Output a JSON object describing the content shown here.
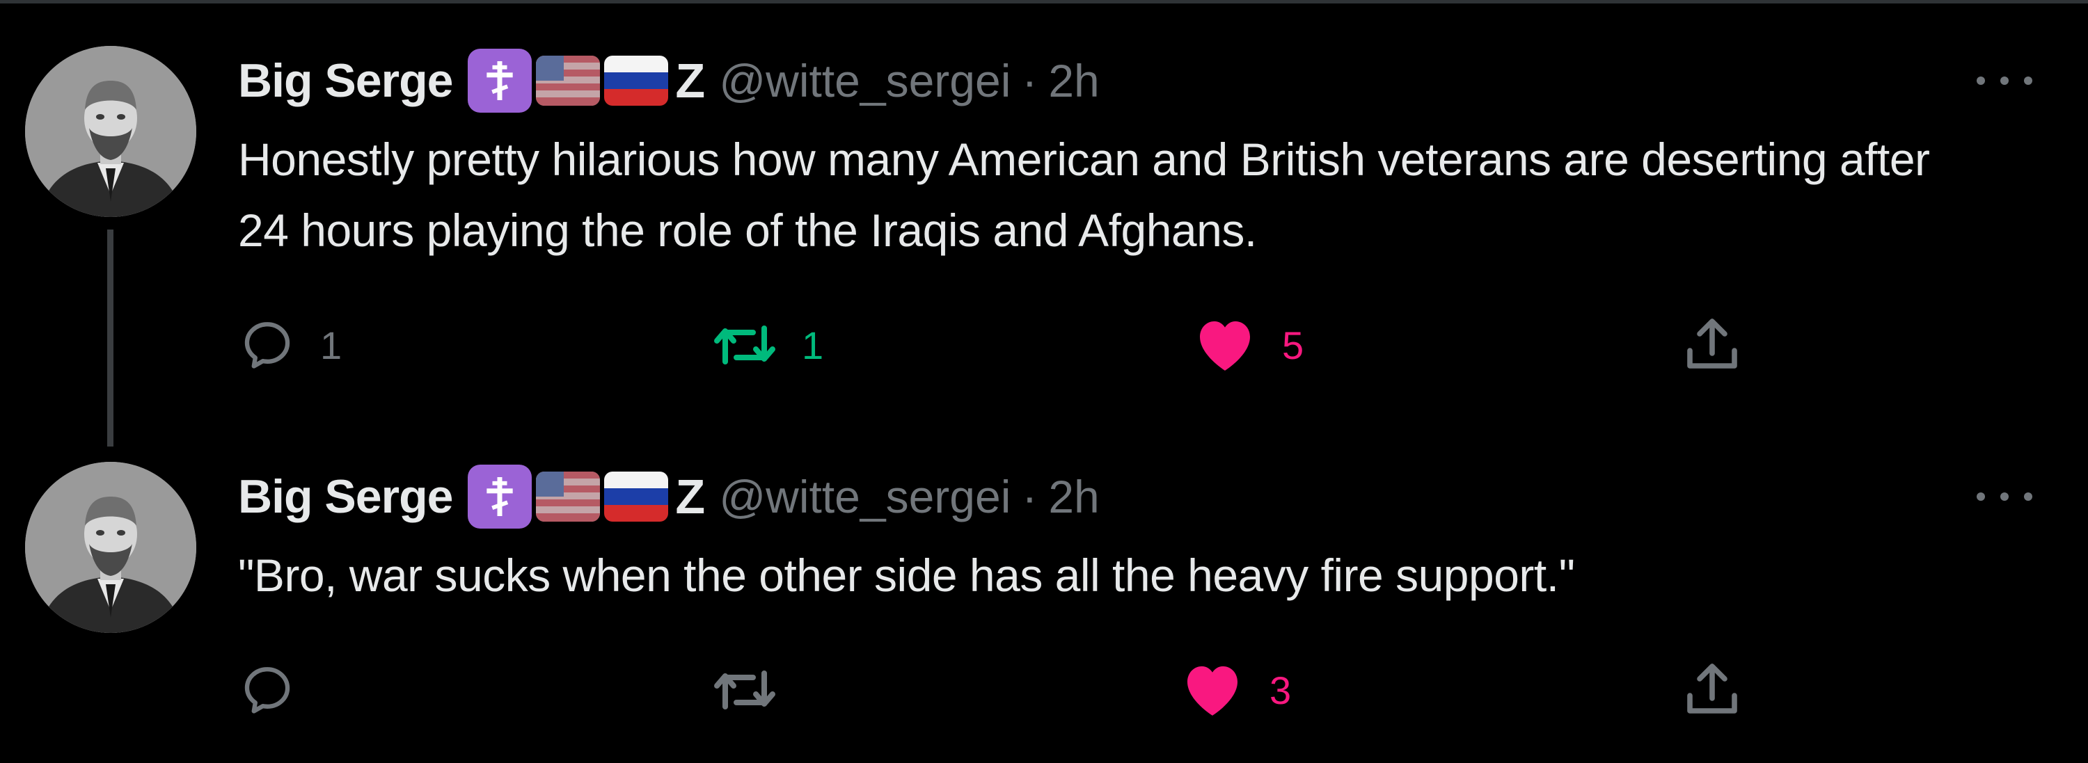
{
  "colors": {
    "background": "#000000",
    "text": "#e7e9ea",
    "muted": "#71767b",
    "retweet_active": "#00ba7c",
    "like_active": "#f91880",
    "badge_purple": "#9b63d6"
  },
  "tweets": [
    {
      "author_name": "Big Serge",
      "badges": [
        "orthodox-cross-icon",
        "us-flag-icon",
        "russia-flag-icon"
      ],
      "z_mark": "Z",
      "handle": "@witte_sergei",
      "separator": "·",
      "time": "2h",
      "text": "Honestly pretty hilarious how many American and British veterans are deserting after 24 hours playing the role of the Iraqis and Afghans.",
      "reply_count": "1",
      "retweet_count": "1",
      "like_count": "5",
      "retweeted": true,
      "liked": true
    },
    {
      "author_name": "Big Serge",
      "badges": [
        "orthodox-cross-icon",
        "us-flag-icon",
        "russia-flag-icon"
      ],
      "z_mark": "Z",
      "handle": "@witte_sergei",
      "separator": "·",
      "time": "2h",
      "text": "\"Bro, war sucks when the other side has all the heavy fire support.\"",
      "reply_count": "",
      "retweet_count": "",
      "like_count": "3",
      "retweeted": false,
      "liked": true
    }
  ]
}
